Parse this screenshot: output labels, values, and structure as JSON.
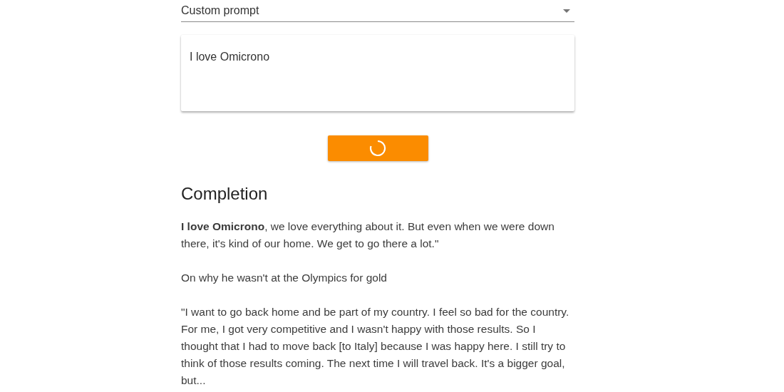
{
  "prompt_select": {
    "value": "Custom prompt"
  },
  "prompt_input": {
    "value": "I love Omicrono"
  },
  "generate_button": {
    "loading": true
  },
  "completion": {
    "heading": "Completion",
    "paragraphs": [
      "**I love Omicrono**, we love everything about it. But even when we were down there, it's kind of our home. We get to go there a lot.\"",
      "On why he wasn't at the Olympics for gold",
      "\"I want to go back home and be part of my country. I feel so bad for the country. For me, I got very competitive and I wasn't happy with those results. So I thought that I had to move back [to Italy] because I was happy here. I still try to think of those results coming. The next time I will travel back. It's a bigger goal, but..."
    ]
  }
}
